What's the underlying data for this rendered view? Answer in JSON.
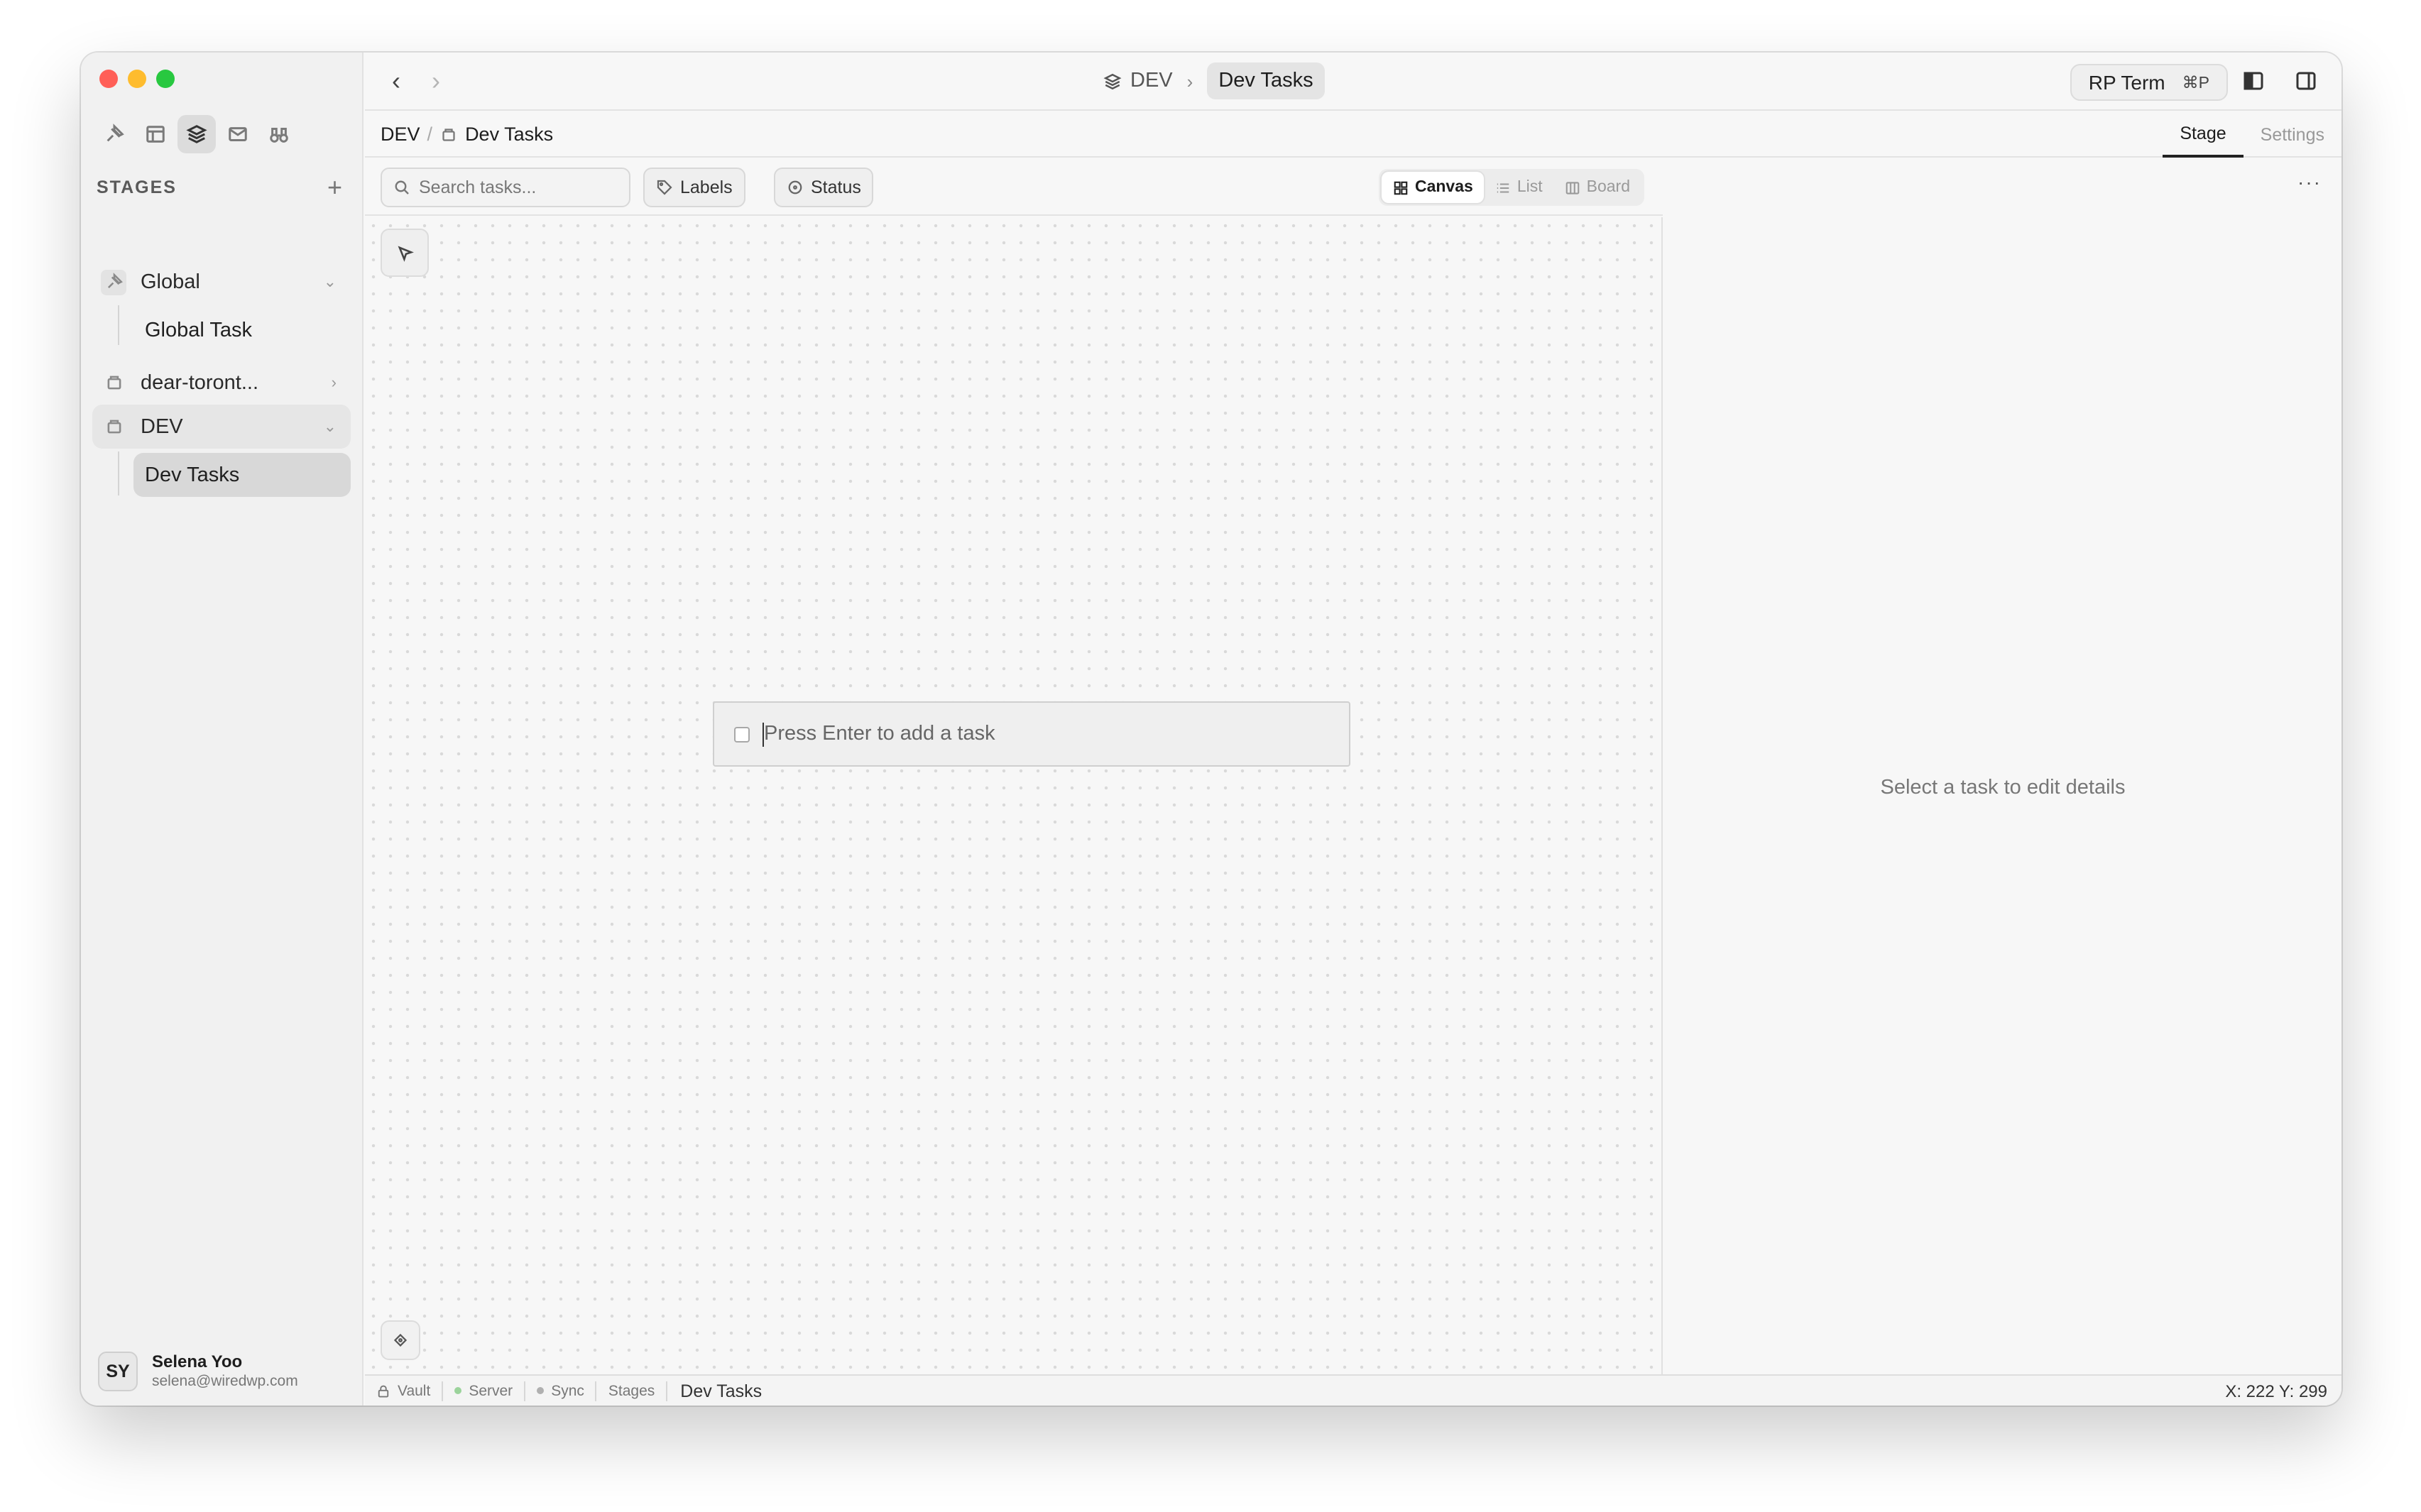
{
  "sidebar": {
    "stages_title": "STAGES",
    "items": [
      {
        "label": "Global",
        "expanded": true,
        "children": [
          "Global Task"
        ]
      },
      {
        "label": "dear-toront...",
        "expanded": false
      },
      {
        "label": "DEV",
        "expanded": true,
        "children": [
          "Dev Tasks"
        ]
      }
    ],
    "user": {
      "initials": "SY",
      "name": "Selena Yoo",
      "email": "selena@wiredwp.com"
    }
  },
  "titlebar": {
    "breadcrumb_parent": "DEV",
    "breadcrumb_current": "Dev Tasks",
    "rp_term_label": "RP Term",
    "rp_term_shortcut": "⌘P"
  },
  "subbar": {
    "path_root": "DEV",
    "path_current": "Dev Tasks",
    "tabs": [
      "Stage",
      "Settings"
    ],
    "active_tab": "Stage"
  },
  "toolbar": {
    "search_placeholder": "Search tasks...",
    "labels_chip": "Labels",
    "status_chip": "Status",
    "views": [
      "Canvas",
      "List",
      "Board"
    ],
    "active_view": "Canvas"
  },
  "canvas": {
    "task_placeholder": "Press Enter to add a task"
  },
  "details": {
    "empty_message": "Select a task to edit details",
    "more_label": "···"
  },
  "statusbar": {
    "vault": "Vault",
    "server": "Server",
    "sync": "Sync",
    "stages": "Stages",
    "title": "Dev Tasks",
    "coords": "X: 222 Y: 299",
    "server_color": "#9bd39b",
    "sync_color": "#b0b0b0"
  },
  "icons": {
    "mode_buttons": [
      "pin-icon",
      "layout-icon",
      "layers-icon",
      "mail-icon",
      "binoculars-icon"
    ],
    "active_mode": "layers-icon"
  }
}
